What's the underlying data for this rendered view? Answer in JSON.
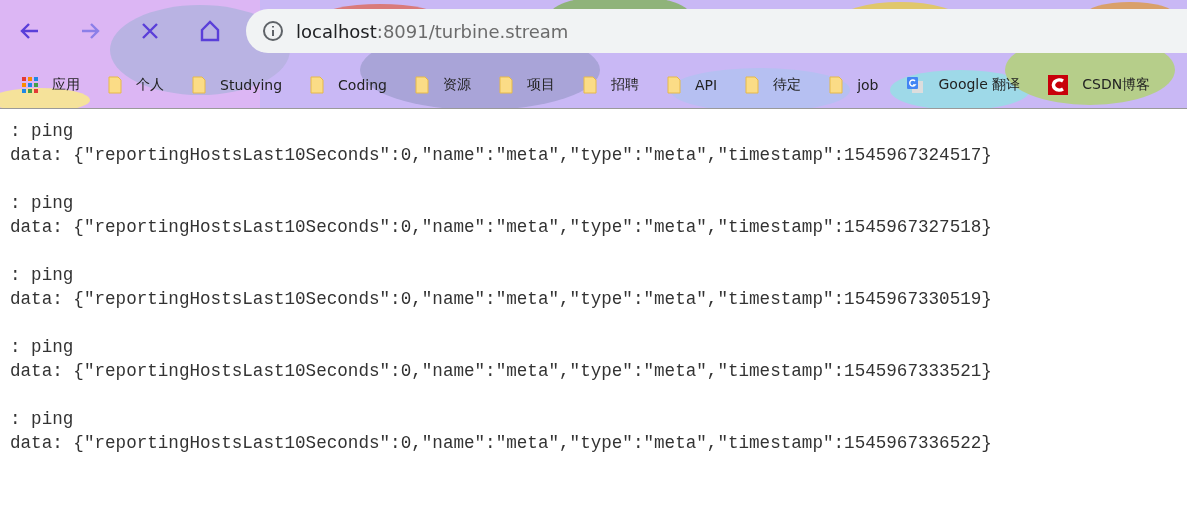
{
  "toolbar": {
    "buttons": [
      {
        "kind": "back",
        "disabled": false
      },
      {
        "kind": "forward",
        "disabled": true
      },
      {
        "kind": "stop",
        "disabled": false
      },
      {
        "kind": "home",
        "disabled": false
      }
    ],
    "address": {
      "host": "localhost",
      "rest": ":8091/turbine.stream"
    }
  },
  "bookmarks": [
    {
      "kind": "apps",
      "label": "应用"
    },
    {
      "kind": "folder",
      "label": "个人"
    },
    {
      "kind": "folder",
      "label": "Studying"
    },
    {
      "kind": "folder",
      "label": "Coding"
    },
    {
      "kind": "folder",
      "label": "资源"
    },
    {
      "kind": "folder",
      "label": "项目"
    },
    {
      "kind": "folder",
      "label": "招聘"
    },
    {
      "kind": "folder",
      "label": "API"
    },
    {
      "kind": "folder",
      "label": "待定"
    },
    {
      "kind": "folder",
      "label": "job"
    },
    {
      "kind": "translate",
      "label": "Google 翻译"
    },
    {
      "kind": "csdn",
      "label": "CSDN博客"
    }
  ],
  "events": [
    {
      "comment": ": ping",
      "data": "data: {\"reportingHostsLast10Seconds\":0,\"name\":\"meta\",\"type\":\"meta\",\"timestamp\":1545967324517}"
    },
    {
      "comment": ": ping",
      "data": "data: {\"reportingHostsLast10Seconds\":0,\"name\":\"meta\",\"type\":\"meta\",\"timestamp\":1545967327518}"
    },
    {
      "comment": ": ping",
      "data": "data: {\"reportingHostsLast10Seconds\":0,\"name\":\"meta\",\"type\":\"meta\",\"timestamp\":1545967330519}"
    },
    {
      "comment": ": ping",
      "data": "data: {\"reportingHostsLast10Seconds\":0,\"name\":\"meta\",\"type\":\"meta\",\"timestamp\":1545967333521}"
    },
    {
      "comment": ": ping",
      "data": "data: {\"reportingHostsLast10Seconds\":0,\"name\":\"meta\",\"type\":\"meta\",\"timestamp\":1545967336522}"
    }
  ]
}
